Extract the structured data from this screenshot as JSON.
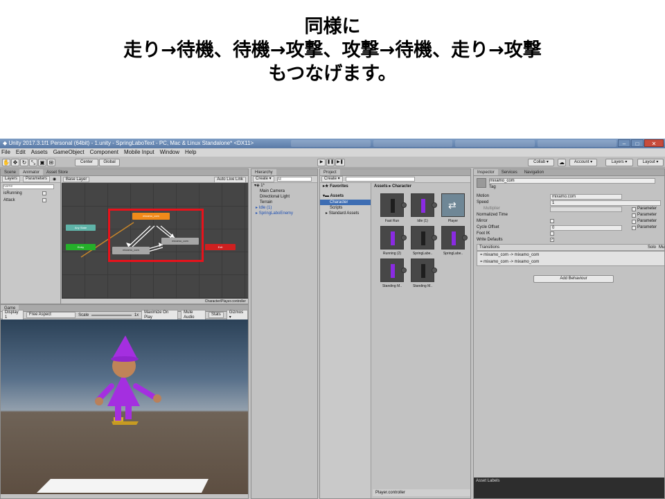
{
  "slide": {
    "line1": "同様に",
    "line2": "走り→待機、待機→攻撃、攻撃→待機、走り→攻撃",
    "line3": "もつなげます。"
  },
  "window": {
    "title": "Unity 2017.3.1f1 Personal (64bit) - 1.unity - SpringLaboText - PC, Mac & Linux Standalone* <DX11>",
    "minimize": "–",
    "restore": "□",
    "close": "✕"
  },
  "menu": [
    "File",
    "Edit",
    "Assets",
    "GameObject",
    "Component",
    "Mobile Input",
    "Window",
    "Help"
  ],
  "toolbar": {
    "center": "Center",
    "global": "Global",
    "collab": "Collab ▾",
    "account": "Account ▾",
    "layers": "Layers ▾",
    "layout": "Layout ▾"
  },
  "animator": {
    "tabs": [
      "Scene",
      "Animator",
      "Asset Store"
    ],
    "layers_tab": "Layers",
    "parameters_tab": "Parameters",
    "search_placeholder": "Name",
    "base_layer": "Base Layer",
    "auto_live_link": "Auto Live Link",
    "parameters": [
      "isRunning",
      "Attack"
    ],
    "states": {
      "any_state": "Any State",
      "entry": "Entry",
      "exit": "Exit",
      "top": "mixamo_com",
      "left": "mixamo_com",
      "right": "mixamo_com"
    },
    "footer": "Character/Player.controller"
  },
  "game": {
    "tab": "Game",
    "display": "Display 1",
    "aspect": "Free Aspect",
    "scale_label": "Scale",
    "scale_value": "1x",
    "maximize": "Maximize On Play",
    "mute": "Mute Audio",
    "stats": "Stats",
    "gizmos": "Gizmos ▾"
  },
  "hierarchy": {
    "tab": "Hierarchy",
    "create": "Create ▾",
    "search_placeholder": "All",
    "scene": "1*",
    "items": [
      "Main Camera",
      "Directional Light",
      "Terrain",
      "Idle (1)",
      "SpringLaboEnemy"
    ]
  },
  "project": {
    "tab": "Project",
    "create": "Create ▾",
    "favorites": "Favorites",
    "assets_root": "Assets",
    "tree": [
      "Character",
      "Scripts",
      "Standard Assets"
    ],
    "breadcrumb_root": "Assets",
    "breadcrumb_sep": "▸",
    "breadcrumb_leaf": "Character",
    "assets": [
      "Fast Run",
      "Idle (1)",
      "Player",
      "Running (2)",
      "SpringLabe..",
      "SpringLabe..",
      "Standing M..",
      "Standing M.."
    ],
    "footer": "Player.controller"
  },
  "play": {
    "play": "▶",
    "pause": "❚❚",
    "step": "▶❚"
  },
  "inspector": {
    "tabs": [
      "Inspector",
      "Services",
      "Navigation"
    ],
    "name": "mixamo_com",
    "tag_label": "Tag",
    "fields": {
      "motion_label": "Motion",
      "motion_value": "mixamo.com",
      "speed_label": "Speed",
      "speed_value": "1",
      "multiplier_label": "Multiplier",
      "normalized_label": "Normalized Time",
      "mirror_label": "Mirror",
      "cycle_label": "Cycle Offset",
      "cycle_value": "0",
      "foot_label": "Foot IK",
      "write_label": "Write Defaults"
    },
    "parameter_label": "Parameter",
    "transitions_label": "Transitions",
    "solo_label": "Solo",
    "mute_label": "Mute",
    "transitions": [
      "mixamo_com -> mixamo_com",
      "mixamo_com -> mixamo_com"
    ],
    "add_behaviour": "Add Behaviour",
    "asset_labels": "Asset Labels"
  },
  "colors": {
    "highlight": "#e8121b",
    "state_orange": "#f08a1a",
    "state_gray": "#a6a6a6",
    "entry_green": "#25b02a",
    "exit_red": "#cf2020",
    "any_teal": "#5fb3a8",
    "character_purple": "#a42fe0"
  }
}
